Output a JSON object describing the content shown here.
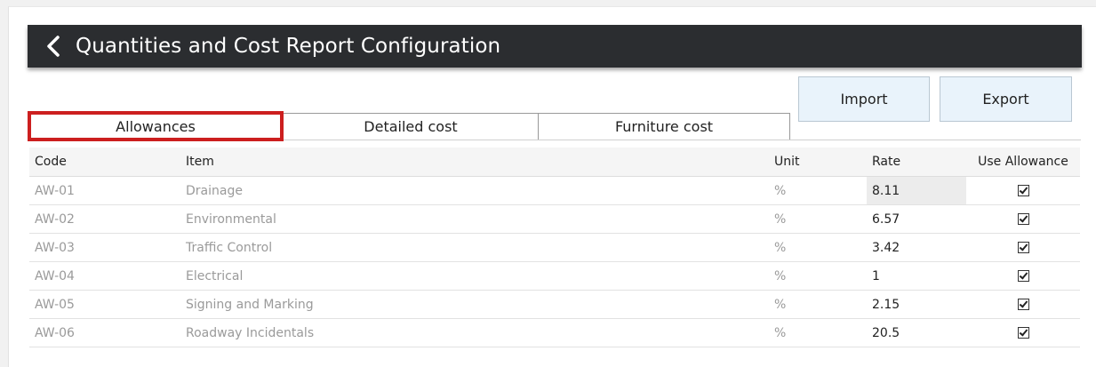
{
  "header": {
    "title": "Quantities and Cost Report Configuration"
  },
  "actions": {
    "import_label": "Import",
    "export_label": "Export"
  },
  "tabs": [
    {
      "label": "Allowances"
    },
    {
      "label": "Detailed cost"
    },
    {
      "label": "Furniture cost"
    }
  ],
  "table": {
    "columns": [
      "Code",
      "Item",
      "Unit",
      "Rate",
      "Use Allowance"
    ],
    "rows": [
      {
        "code": "AW-01",
        "item": "Drainage",
        "unit": "%",
        "rate": "8.11",
        "use": true
      },
      {
        "code": "AW-02",
        "item": "Environmental",
        "unit": "%",
        "rate": "6.57",
        "use": true
      },
      {
        "code": "AW-03",
        "item": "Traffic Control",
        "unit": "%",
        "rate": "3.42",
        "use": true
      },
      {
        "code": "AW-04",
        "item": "Electrical",
        "unit": "%",
        "rate": "1",
        "use": true
      },
      {
        "code": "AW-05",
        "item": "Signing and Marking",
        "unit": "%",
        "rate": "2.15",
        "use": true
      },
      {
        "code": "AW-06",
        "item": "Roadway Incidentals",
        "unit": "%",
        "rate": "20.5",
        "use": true
      }
    ]
  },
  "colors": {
    "header_bg": "#2b2d30",
    "highlight_border": "#cc1f1f",
    "button_bg": "#e9f3fb"
  },
  "icons": {
    "back": "chevron-left-icon",
    "checkbox": "checkbox-checked-icon"
  }
}
